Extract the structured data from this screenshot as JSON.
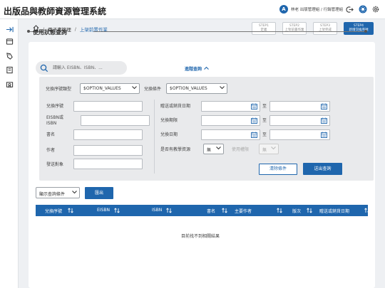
{
  "app": {
    "title": "出版品與教師資源管理系統"
  },
  "user": {
    "initial": "A",
    "name": "林老 出版管理組 / 行銷管理組"
  },
  "breadcrumb": {
    "level1": "電子書管理",
    "separator": "/",
    "current": "上架前置作業"
  },
  "steps": [
    {
      "line1": "STEP1",
      "line2": "定義"
    },
    {
      "line1": "STEP2",
      "line2": "上架前置作業"
    },
    {
      "line1": "STEP3",
      "line2": "上架完成"
    },
    {
      "line1": "STEP4",
      "line2": "新增交換序號"
    }
  ],
  "section": {
    "title": "使用狀態查詢"
  },
  "search": {
    "placeholder": "請輸入 EISBN、ISBN、..."
  },
  "advanced": {
    "label": "進階查詢"
  },
  "filters": {
    "exchange_type_label": "兌換序號類型",
    "exchange_type_value": "$OPTION_VALUES",
    "exchange_cond_label": "兌換條件",
    "exchange_cond_value": "$OPTION_VALUES",
    "serial_label": "兌換序號",
    "eisbn_label": "EISBN或ISBN",
    "book_label": "書名",
    "author_label": "作者",
    "target_label": "發送對象",
    "gift_date_label": "贈送或銷貨日期",
    "period_label": "兌換期限",
    "redeem_date_label": "兌換日期",
    "to": "至",
    "teacher_label": "是否有教學資源",
    "teacher_value": "無",
    "usage_label": "使用權限",
    "usage_value": "無"
  },
  "buttons": {
    "clear": "清除條件",
    "submit": "送出查詢",
    "export": "匯出"
  },
  "display_select": {
    "value": "顯示查詢條件"
  },
  "table": {
    "columns": [
      "兌換序號",
      "EISBN",
      "ISBN",
      "書名",
      "主要作者",
      "版次",
      "贈送或銷貨日期"
    ],
    "empty_message": "目前找不到相關結果"
  },
  "colors": {
    "primary": "#1f66ad",
    "panel": "#e9eaec"
  }
}
